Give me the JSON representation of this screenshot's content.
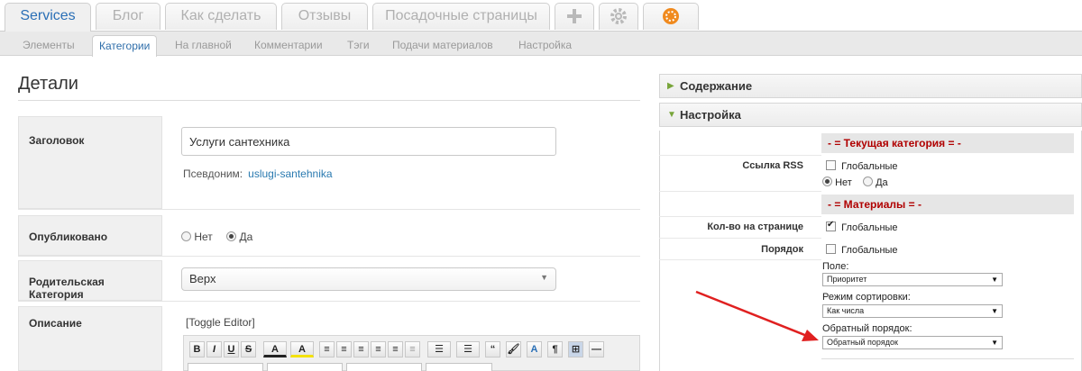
{
  "top_tabs": [
    {
      "label": "Services",
      "active": true
    },
    {
      "label": "Блог",
      "active": false
    },
    {
      "label": "Как сделать",
      "active": false
    },
    {
      "label": "Отзывы",
      "active": false
    },
    {
      "label": "Посадочные страницы",
      "active": false
    }
  ],
  "top_icons": [
    "plus-icon",
    "gear-icon",
    "addon-icon"
  ],
  "sub_tabs": [
    {
      "label": "Элементы",
      "active": false
    },
    {
      "label": "Категории",
      "active": true
    },
    {
      "label": "На главной",
      "active": false
    },
    {
      "label": "Комментарии",
      "active": false
    },
    {
      "label": "Тэги",
      "active": false
    },
    {
      "label": "Подачи материалов",
      "active": false
    },
    {
      "label": "Настройка",
      "active": false
    }
  ],
  "details": {
    "title": "Детали",
    "fields": {
      "title_label": "Заголовок",
      "title_value": "Услуги сантехника",
      "alias_label": "Псевдоним:",
      "alias_value": "uslugi-santehnika",
      "published_label": "Опубликовано",
      "published_no": "Нет",
      "published_yes": "Да",
      "published_value": "Да",
      "parent_label": "Родительская Категория",
      "parent_value": "Верх",
      "description_label": "Описание",
      "toggle_editor": "[Toggle Editor]"
    }
  },
  "editor_toolbar": {
    "buttons": [
      "B",
      "I",
      "U",
      "S",
      "A",
      "A",
      "≡",
      "≡",
      "≡",
      "≡",
      "≡",
      "≡",
      "☰",
      "☰",
      "“",
      "🖌",
      "A",
      "¶",
      "⊞",
      "—"
    ]
  },
  "right_panel": {
    "content_header": "Содержание",
    "settings_header": "Настройка",
    "section_current_category": "- = Текущая категория = -",
    "rss_label": "Ссылка RSS",
    "rss_global": "Глобальные",
    "rss_no": "Нет",
    "rss_yes": "Да",
    "rss_value": "Нет",
    "section_materials": "- = Материалы = -",
    "per_page_label": "Кол-во на странице",
    "per_page_global": "Глобальные",
    "per_page_global_checked": true,
    "order_label": "Порядок",
    "order_global": "Глобальные",
    "order_global_checked": false,
    "field_label": "Поле:",
    "field_value": "Приоритет",
    "sort_mode_label": "Режим сортировки:",
    "sort_mode_value": "Как числа",
    "reverse_label": "Обратный порядок:",
    "reverse_value": "Обратный порядок"
  },
  "colors": {
    "accent_blue": "#2a6fb6",
    "section_red": "#b00000",
    "arrow_red": "#e02020",
    "header_green": "#78a53a"
  }
}
